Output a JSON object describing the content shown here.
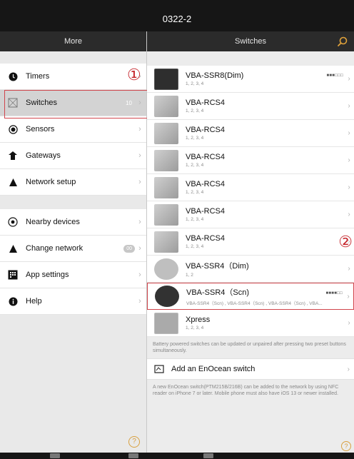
{
  "app": {
    "title": "0322-2"
  },
  "nav": {
    "left_title": "More",
    "right_title": "Switches"
  },
  "menu_items": [
    {
      "label": "Timers",
      "icon": "clock-icon"
    },
    {
      "label": "Switches",
      "icon": "switch-icon",
      "count": "10",
      "selected": true
    },
    {
      "label": "Sensors",
      "icon": "sensor-icon"
    },
    {
      "label": "Gateways",
      "icon": "gateway-icon"
    },
    {
      "label": "Network setup",
      "icon": "network-icon"
    }
  ],
  "menu_items2": [
    {
      "label": "Nearby devices",
      "icon": "nearby-icon"
    },
    {
      "label": "Change network",
      "icon": "network-icon",
      "badge": "00"
    },
    {
      "label": "App settings",
      "icon": "grid-icon"
    },
    {
      "label": "Help",
      "icon": "info-icon"
    }
  ],
  "annotations": {
    "mark1": "①",
    "mark2": "②"
  },
  "switches": [
    {
      "name": "VBA-SSR8(Dim)",
      "sub": "1, 2, 3, 4",
      "thumb": "dark",
      "signal": "■■■□□□"
    },
    {
      "name": "VBA-RCS4",
      "sub": "1, 2, 3, 4",
      "thumb": "silver"
    },
    {
      "name": "VBA-RCS4",
      "sub": "1, 2, 3, 4",
      "thumb": "silver"
    },
    {
      "name": "VBA-RCS4",
      "sub": "1, 2, 3, 4",
      "thumb": "silver"
    },
    {
      "name": "VBA-RCS4",
      "sub": "1, 2, 3, 4",
      "thumb": "silver"
    },
    {
      "name": "VBA-RCS4",
      "sub": "1, 2, 3, 4",
      "thumb": "silver"
    },
    {
      "name": "VBA-RCS4",
      "sub": "1, 2, 3, 4",
      "thumb": "silver"
    },
    {
      "name": "VBA-SSR4（Dim)",
      "sub": "1, 2",
      "thumb": "round"
    },
    {
      "name": "VBA-SSR4（Scn)",
      "sub": "VBA-SSR4（Scn) , VBA-SSR4（Scn) , VBA-SSR4（Scn) , VBA...",
      "thumb": "blackround",
      "signal": "■■■■□□",
      "highlighted": true
    },
    {
      "name": "Xpress",
      "sub": "1, 2, 3, 4",
      "thumb": "sq"
    }
  ],
  "notes": {
    "battery": "Battery powered switches can be updated or unpaired after pressing two preset buttons simultaneously.",
    "add_label": "Add an EnOcean switch",
    "nfc": "A new EnOcean switch(PTM215B/216B) can be added to the network by using NFC reader on iPhone 7 or later. Mobile phone must also have iOS 13 or newer installed."
  },
  "help_glyph": "?",
  "colors": {
    "accent": "#d8a040",
    "highlight": "#d0454c",
    "nav": "#2b2b2b"
  }
}
